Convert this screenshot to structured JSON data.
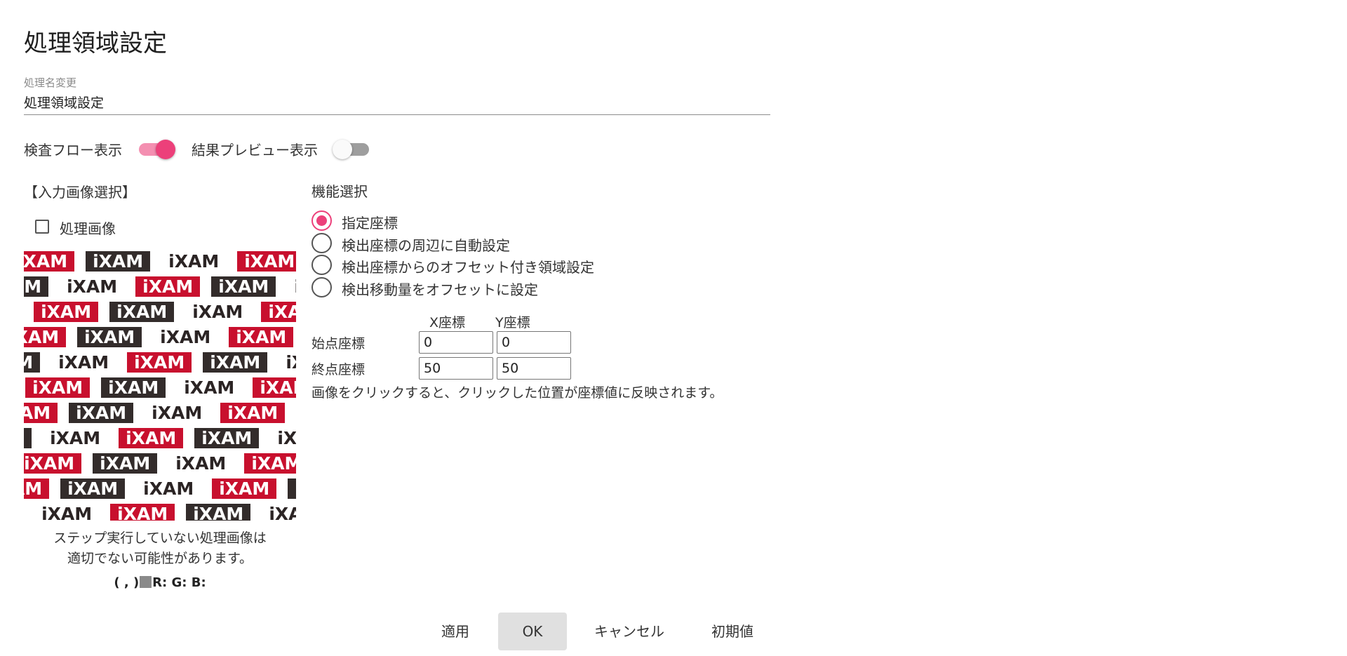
{
  "dialog": {
    "title": "処理領域設定"
  },
  "name_field": {
    "label": "処理名変更",
    "value": "処理領域設定"
  },
  "toggles": [
    {
      "label": "検査フロー表示",
      "on": true
    },
    {
      "label": "結果プレビュー表示",
      "on": false
    }
  ],
  "colors": {
    "accent": "#ec407a",
    "accent_track": "#f48fb1",
    "off_thumb": "#fafafa",
    "off_track": "#9e9e9e",
    "logo_red": "#c8102e",
    "logo_dark": "#332c2b"
  },
  "input_image": {
    "section_label": "【入力画像選択】",
    "checkbox_label": "処理画像",
    "checkbox_checked": false,
    "logo_text": "iXAM",
    "note_line1": "ステップ実行していない処理画像は",
    "note_line2": "適切でない可能性があります。",
    "pixel_coord": "( , )",
    "pixel_rgb": "R: G: B:"
  },
  "function_select": {
    "label": "機能選択",
    "options": [
      {
        "label": "指定座標",
        "selected": true
      },
      {
        "label": "検出座標の周辺に自動設定",
        "selected": false
      },
      {
        "label": "検出座標からのオフセット付き領域設定",
        "selected": false
      },
      {
        "label": "検出移動量をオフセットに設定",
        "selected": false
      }
    ]
  },
  "coordinates": {
    "x_header": "X座標",
    "y_header": "Y座標",
    "start_label": "始点座標",
    "end_label": "終点座標",
    "start_x": "0",
    "start_y": "0",
    "end_x": "50",
    "end_y": "50",
    "hint": "画像をクリックすると、クリックした位置が座標値に反映されます。"
  },
  "buttons": {
    "apply": "適用",
    "ok": "OK",
    "cancel": "キャンセル",
    "default": "初期値"
  }
}
